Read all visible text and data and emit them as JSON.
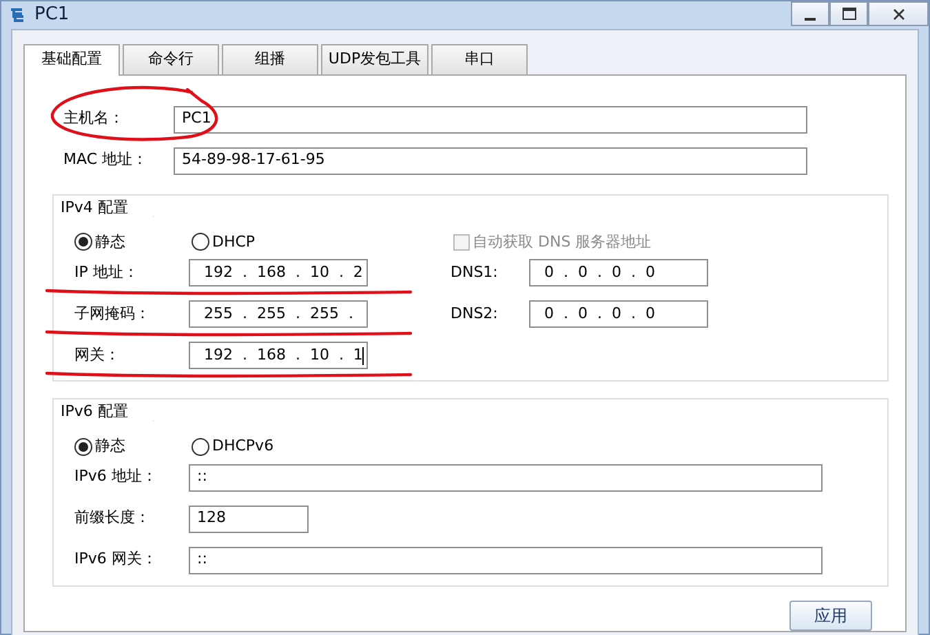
{
  "window": {
    "title": "PC1"
  },
  "tabs": [
    {
      "label": "基础配置",
      "selected": true
    },
    {
      "label": "命令行",
      "selected": false
    },
    {
      "label": "组播",
      "selected": false
    },
    {
      "label": "UDP发包工具",
      "selected": false
    },
    {
      "label": "串口",
      "selected": false
    }
  ],
  "host": [
    {
      "label": "主机名：",
      "value": "PC1",
      "circled": true
    },
    {
      "label": "MAC 地址：",
      "value": "54-89-98-17-61-95",
      "circled": false
    }
  ],
  "ipv4": {
    "title": "IPv4 配置",
    "modes": [
      {
        "label": "静态",
        "selected": true
      },
      {
        "label": "DHCP",
        "selected": false
      }
    ],
    "dns_auto": {
      "label": "自动获取 DNS 服务器地址",
      "checked": false,
      "disabled": true
    },
    "fields": [
      {
        "label": "IP 地址：",
        "value": "192 . 168 . 10 . 2",
        "underlined": true,
        "focused": false
      },
      {
        "label": "子网掩码：",
        "value": "255 . 255 . 255 .",
        "underlined": true,
        "focused": false
      },
      {
        "label": "网关：",
        "value": "192 . 168 . 10 . 1",
        "underlined": true,
        "focused": true
      }
    ],
    "dns": [
      {
        "label": "DNS1:",
        "value": "0 . 0 . 0 . 0"
      },
      {
        "label": "DNS2:",
        "value": "0 . 0 . 0 . 0"
      }
    ]
  },
  "ipv6": {
    "title": "IPv6 配置",
    "modes": [
      {
        "label": "静态",
        "selected": true
      },
      {
        "label": "DHCPv6",
        "selected": false
      }
    ],
    "fields": [
      {
        "label": "IPv6 地址：",
        "value": "::",
        "kind": "wide"
      },
      {
        "label": "前缀长度：",
        "value": "128",
        "kind": "short"
      },
      {
        "label": "IPv6 网关：",
        "value": "::",
        "kind": "wide"
      }
    ]
  },
  "buttons": [
    {
      "label": "应用"
    }
  ]
}
